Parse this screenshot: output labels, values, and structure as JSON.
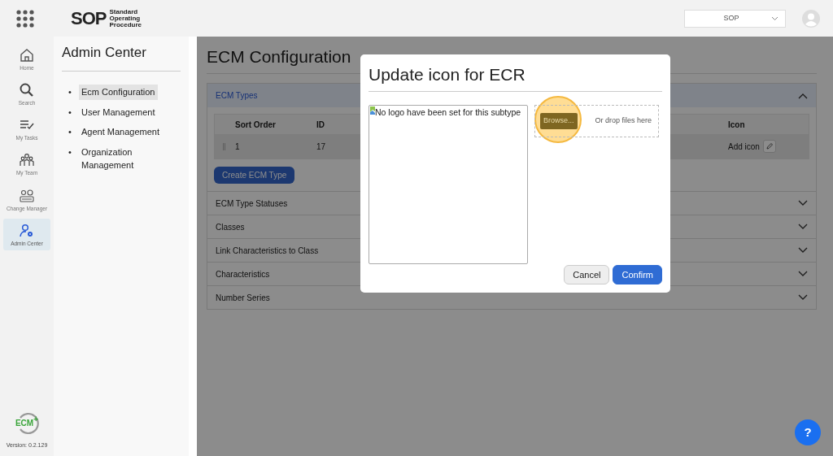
{
  "app_bar": {
    "logo": "SOP",
    "logo_tagline": "Standard Operating Procedure",
    "workspace_select": {
      "value": "SOP"
    }
  },
  "nav_rail": {
    "items": [
      {
        "label": "Home",
        "selected": false
      },
      {
        "label": "Search",
        "selected": false
      },
      {
        "label": "My Tasks",
        "selected": false
      },
      {
        "label": "My Team",
        "selected": false
      },
      {
        "label": "Change Manager",
        "selected": false
      },
      {
        "label": "Admin Center",
        "selected": true
      }
    ],
    "footer_logo": {
      "text": "ECM",
      "badge": "+"
    },
    "version": "Version: 0.2.129"
  },
  "sidebar": {
    "title": "Admin Center",
    "items": [
      {
        "bullet": "•",
        "label": "Ecm Configuration",
        "selected": true
      },
      {
        "bullet": "•",
        "label": "User Management",
        "selected": false
      },
      {
        "bullet": "•",
        "label": "Agent Management",
        "selected": false
      },
      {
        "bullet": "•",
        "label": "Organization Management",
        "selected": false
      }
    ]
  },
  "page": {
    "title": "ECM Configuration",
    "sections": [
      {
        "title": "ECM Types",
        "expanded": true,
        "table": {
          "columns": [
            "Sort Order",
            "ID",
            "Icon"
          ],
          "rows": [
            {
              "sort_order": "1",
              "id": "17",
              "icon_action": "Add icon",
              "selected": true
            }
          ]
        },
        "button": "Create ECM Type"
      },
      {
        "title": "ECM Type Statuses",
        "expanded": false
      },
      {
        "title": "Classes",
        "expanded": false
      },
      {
        "title": "Link Characteristics to Class",
        "expanded": false
      },
      {
        "title": "Characteristics",
        "expanded": false
      },
      {
        "title": "Number Series",
        "expanded": false
      }
    ]
  },
  "dialog": {
    "title": "Update icon for ECR",
    "preview_alt": "No logo have been set for this subtype",
    "browse_button": {
      "label": "Browse...",
      "highlighted": true
    },
    "drop_hint": "Or drop files here",
    "buttons": [
      {
        "label": "Cancel",
        "kind": "secondary"
      },
      {
        "label": "Confirm",
        "kind": "primary"
      }
    ]
  },
  "help_button": "?"
}
